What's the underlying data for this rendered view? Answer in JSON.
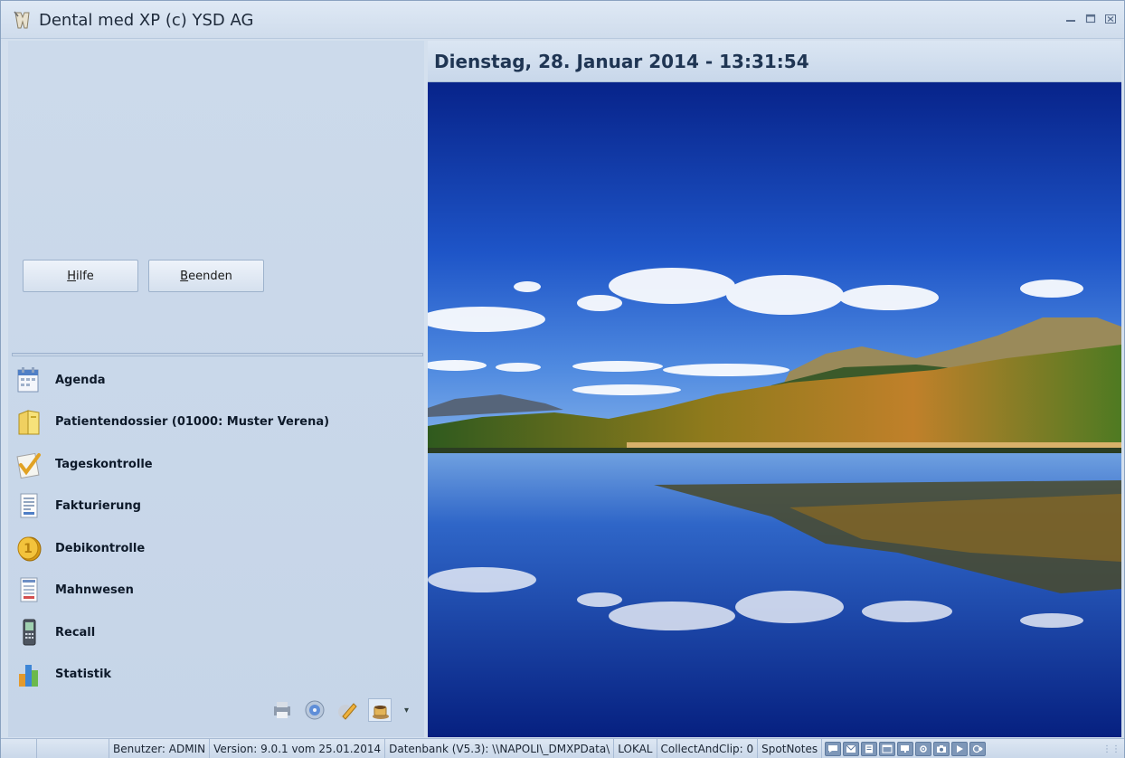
{
  "window": {
    "title": "Dental med XP (c) YSD AG"
  },
  "buttons": {
    "help": {
      "prefix": "H",
      "rest": "ilfe"
    },
    "quit": {
      "prefix": "B",
      "rest": "eenden"
    }
  },
  "nav": {
    "items": [
      {
        "label": "Agenda",
        "icon": "calendar-icon"
      },
      {
        "label": "Patientendossier (01000: Muster Verena)",
        "icon": "folder-icon"
      },
      {
        "label": "Tageskontrolle",
        "icon": "checkmark-icon"
      },
      {
        "label": "Fakturierung",
        "icon": "invoice-icon"
      },
      {
        "label": "Debikontrolle",
        "icon": "coin-icon"
      },
      {
        "label": "Mahnwesen",
        "icon": "document-list-icon"
      },
      {
        "label": "Recall",
        "icon": "phone-icon"
      },
      {
        "label": "Statistik",
        "icon": "bar-chart-icon"
      }
    ]
  },
  "header": {
    "datetime": "Dienstag, 28. Januar 2014 - 13:31:54"
  },
  "statusbar": {
    "user": "Benutzer: ADMIN",
    "version": "Version: 9.0.1 vom 25.01.2014",
    "database": "Datenbank (V5.3): \\\\NAPOLI\\_DMXPData\\",
    "mode": "LOKAL",
    "collect": "CollectAndClip: 0",
    "spotnotes": "SpotNotes"
  },
  "colors": {
    "window_bg": "#d4e0ee",
    "header_text": "#1f3553",
    "sky_top": "#0a2a8a",
    "lake": "#0d2f88"
  }
}
